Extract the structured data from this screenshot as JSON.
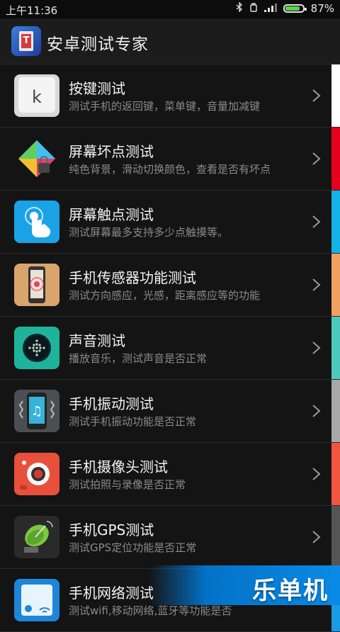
{
  "status_bar": {
    "time": "上午11:36",
    "battery_percent": "87%",
    "battery_level": 0.87
  },
  "header": {
    "title": "安卓测试专家",
    "logo_letter": "T"
  },
  "items": [
    {
      "title": "按键测试",
      "desc": "测试手机的返回键，菜单键，音量加减键",
      "icon": "key-icon",
      "tab_color": "#ffffff"
    },
    {
      "title": "屏幕坏点测试",
      "desc": "纯色背景，滑动切换颜色，查看是否有坏点",
      "icon": "color-prism-icon",
      "tab_color": "#e5001c"
    },
    {
      "title": "屏幕触点测试",
      "desc": "测试屏幕最多支持多少点触摸等。",
      "icon": "touch-icon",
      "tab_color": "#14b4e8"
    },
    {
      "title": "手机传感器功能测试",
      "desc": "测试方向感应，光感，距离感应等的功能",
      "icon": "sensor-icon",
      "tab_color": "#f0a060"
    },
    {
      "title": "声音测试",
      "desc": "播放音乐，测试声音是否正常",
      "icon": "speaker-icon",
      "tab_color": "#4cc8bc"
    },
    {
      "title": "手机振动测试",
      "desc": "测试手机振动功能是否正常",
      "icon": "vibration-icon",
      "tab_color": "#a8a8a8"
    },
    {
      "title": "手机摄像头测试",
      "desc": "测试拍照与录像是否正常",
      "icon": "camera-icon",
      "tab_color": "#f0563e"
    },
    {
      "title": "手机GPS测试",
      "desc": "测试GPS定位功能是否正常",
      "icon": "satellite-dish-icon",
      "tab_color": "#555555"
    },
    {
      "title": "手机网络测试",
      "desc": "测试wifi,移动网络,蓝牙等功能是否",
      "icon": "network-icon",
      "tab_color": "#1a9be6"
    }
  ],
  "brand": {
    "text": "乐单机"
  }
}
